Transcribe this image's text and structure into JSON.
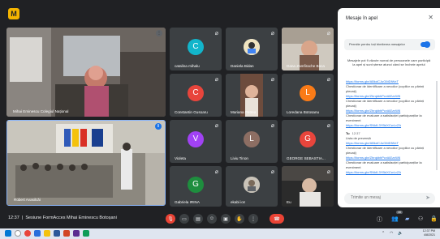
{
  "meeting": {
    "time": "12:37",
    "title": "Sesiune FormAcces Mihai Eminescu Botoșani",
    "logo_glyph": "M"
  },
  "tiles": {
    "big_top_name": "Mihai Eminescu Colegiul Național",
    "big_bottom_name": "Robert Avasilcăi",
    "participants": [
      {
        "name": "catalina mihalu",
        "initial": "C",
        "color": "#12b5cb"
      },
      {
        "name": "Daniela Bidan",
        "initial": "",
        "color": "#a8c7fa"
      },
      {
        "name": "Dana Zamfirache Boca",
        "initial": "",
        "color": ""
      },
      {
        "name": "Constantin Gusoaru",
        "initial": "C",
        "color": "#e8453c"
      },
      {
        "name": "Mariana Petrea",
        "initial": "",
        "color": ""
      },
      {
        "name": "Loredana Botosanu",
        "initial": "L",
        "color": "#fa7b17"
      },
      {
        "name": "Violeta",
        "initial": "V",
        "color": "#a142f4"
      },
      {
        "name": "Liviu Tinon",
        "initial": "L",
        "color": "#8d6e63"
      },
      {
        "name": "GEORGE SEBASTIA...",
        "initial": "G",
        "color": "#e8453c"
      },
      {
        "name": "Gabriela IRINA",
        "initial": "G",
        "color": "#1e8e3e"
      },
      {
        "name": "ekabi ion",
        "initial": "",
        "color": ""
      },
      {
        "name": "Eu",
        "initial": "",
        "color": ""
      }
    ]
  },
  "chat": {
    "title": "Mesaje în apel",
    "toggle_label": "Permite pentru toți trimiterea mesajelor",
    "note": "Mesajele pot fi văzute numai de persoanele care participă la apel și sunt șterse atunci când se încheie apelul",
    "messages": [
      {
        "kind": "link",
        "text": "https://forms.gle/ABkdCJuG6tDfWxT"
      },
      {
        "kind": "text",
        "text": "Chestionar de identificare a nevoilor (copiilor cu părinți plecați)"
      },
      {
        "kind": "link",
        "text": "https://forms.gle/ZhrqkbhPcviAEzxW6"
      },
      {
        "kind": "text",
        "text": "Chestionar de identificare a nevoilor (copiilor cu părinți plecați)"
      },
      {
        "kind": "link",
        "text": "https://forms.gle/ZhrqkbhPcviAEzxW6"
      },
      {
        "kind": "text",
        "text": "Chestionar de evaluare a satisfacției participanților la eveniment"
      },
      {
        "kind": "link",
        "text": "https://forms.gle/SNkfL3YBdXCwLvZA"
      },
      {
        "kind": "header",
        "sender": "Tu",
        "time": "12:37"
      },
      {
        "kind": "text",
        "text": "Lista de prezență"
      },
      {
        "kind": "link",
        "text": "https://forms.gle/ABkdCJuG6tDfWxT"
      },
      {
        "kind": "text",
        "text": "Chestionar de identificare a nevoilor (copiilor cu părinți plecați)"
      },
      {
        "kind": "link",
        "text": "https://forms.gle/ZhrqkbhPcviAEzxW6"
      },
      {
        "kind": "text",
        "text": "Chestionar de evaluare a satisfacției participanților la eveniment"
      },
      {
        "kind": "link",
        "text": "https://forms.gle/SNkfL3YBdXCwLvZA"
      }
    ],
    "input_placeholder": "Trimite un mesaj"
  },
  "controls": {
    "participant_count": "16"
  },
  "taskbar": {
    "time": "12:37 PM",
    "date": "4/8/2021"
  },
  "colors": {
    "background": "#202124",
    "accent": "#1a73e8",
    "danger": "#ea4335"
  }
}
